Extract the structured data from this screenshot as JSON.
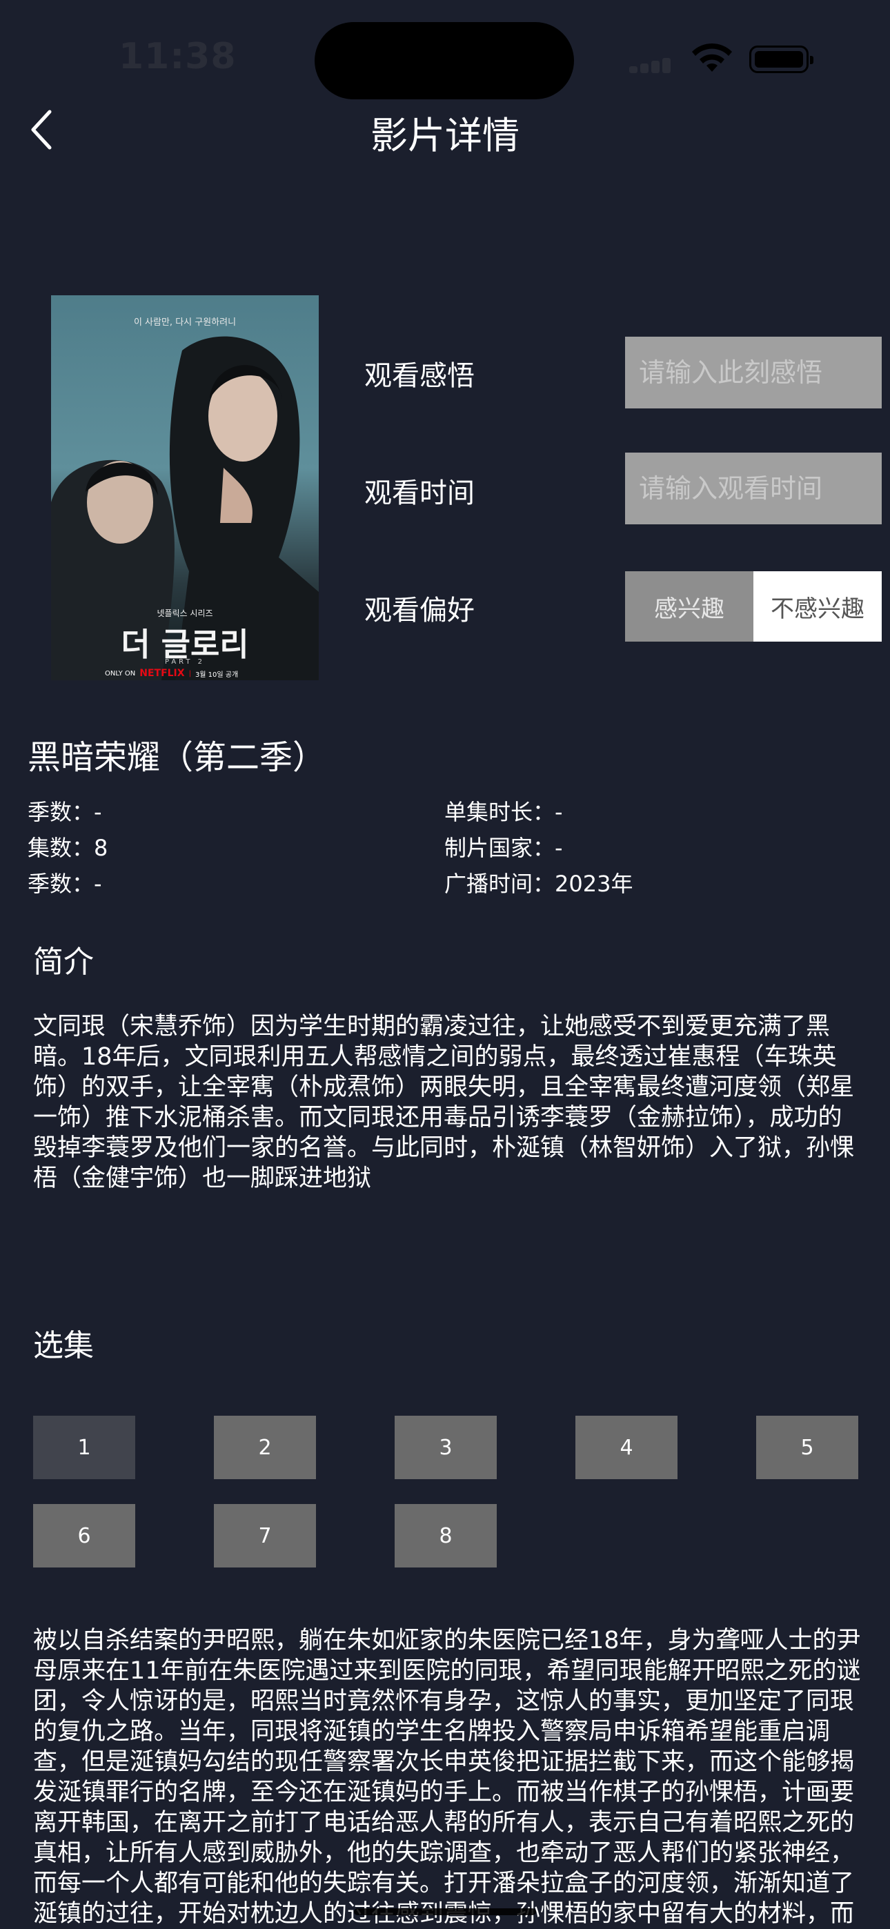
{
  "status_bar": {
    "time": "11:38"
  },
  "nav": {
    "title": "影片详情"
  },
  "poster": {
    "top_text": "이 사람만, 다시 구원하려니",
    "series_text": "넷플릭스 시리즈",
    "main_title": "더 글로리",
    "part": "PART 2",
    "only_on": "ONLY ON",
    "brand": "NETFLIX",
    "release": "3월 10일 공개",
    "colors": {
      "bg_top": "#6f98a3",
      "bg_bottom": "#1a2327",
      "brand": "#e50914"
    }
  },
  "form": {
    "thoughts_label": "观看感悟",
    "thoughts_placeholder": "请输入此刻感悟",
    "time_label": "观看时间",
    "time_placeholder": "请输入观看时间",
    "preference_label": "观看偏好",
    "preference_options": [
      "感兴趣",
      "不感兴趣"
    ],
    "preference_selected": "感兴趣"
  },
  "movie": {
    "title": "黑暗荣耀（第二季）",
    "season": "季数：-",
    "episode_length": "单集时长：-",
    "episodes": "集数：8",
    "country": "制片国家：-",
    "season_again": "季数：-",
    "broadcast": "广播时间：2023年"
  },
  "synopsis": {
    "heading": "简介",
    "text": "文同珢（宋慧乔饰）因为学生时期的霸凌过往，让她感受不到爱更充满了黑暗。18年后，文同珢利用五人帮感情之间的弱点，最终透过崔惠程（车珠英饰）的双手，让全宰寯（朴成焄饰）两眼失明，且全宰寯最终遭河度领（郑星一饰）推下水泥桶杀害。而文同珢还用毒品引诱李蓑罗（金赫拉饰），成功的毁掉李蓑罗及他们一家的名誉。与此同时，朴涎镇（林智妍饰）入了狱，孙惈梧（金健宇饰）也一脚踩进地狱"
  },
  "episodes_section": {
    "heading": "选集",
    "items": [
      "1",
      "2",
      "3",
      "4",
      "5",
      "6",
      "7",
      "8"
    ],
    "selected": "1"
  },
  "episode_summary": {
    "text": "被以自杀结案的尹昭熙，躺在朱如炡家的朱医院已经18年，身为聋哑人士的尹母原来在11年前在朱医院遇过来到医院的同珢，希望同珢能解开昭熙之死的谜团，令人惊讶的是，昭熙当时竟然怀有身孕，这惊人的事实，更加坚定了同珢的复仇之路。当年，同珢将涎镇的学生名牌投入警察局申诉箱希望能重启调查，但是涎镇妈勾结的现任警察署次长申英俊把证据拦截下来，而这个能够揭发涎镇罪行的名牌，至今还在涎镇妈的手上。而被当作棋子的孙惈梧，计画要离开韩国，在离开之前打了电话给恶人帮的所有人，表示自己有着昭熙之死的真相，让所有人感到威胁外，他的失踪调查，也牵动了恶人帮们的紧张神经，而每一个人都有可能和他的失踪有关。打开潘朵拉盒子的河度领，渐渐知道了涎镇的过往，开始对枕边人的过往感到震惊，孙惈梧的家中留有大的材料，而林涎镇疑虑他每个家庭的"
  }
}
